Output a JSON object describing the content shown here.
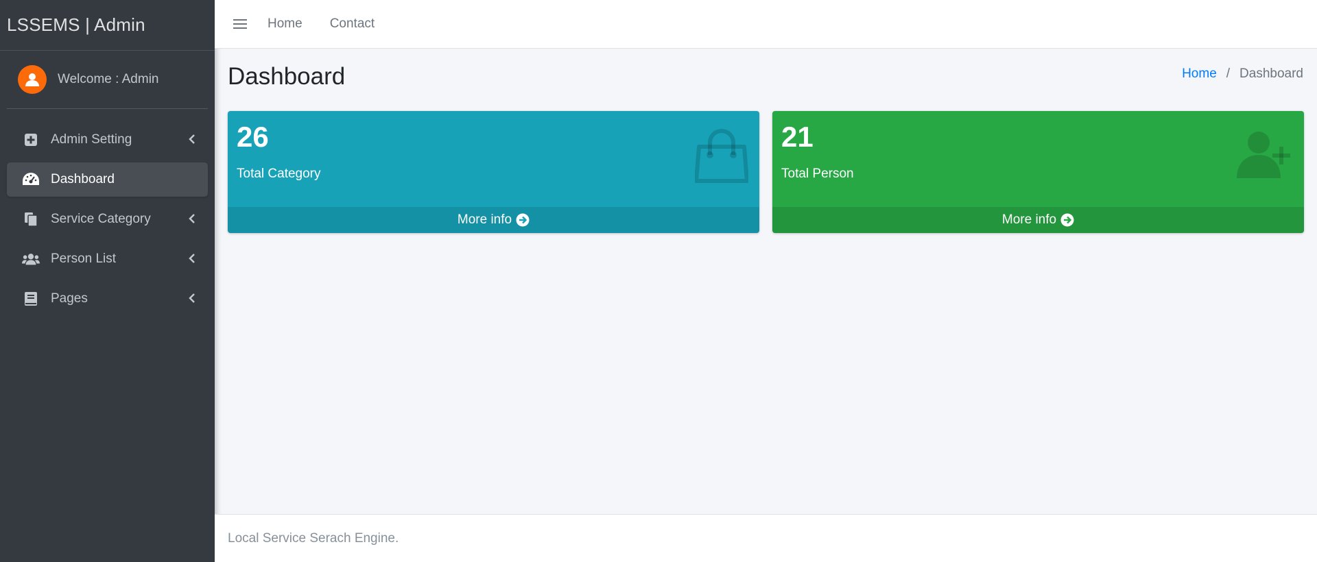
{
  "brand": {
    "title": "LSSEMS | Admin"
  },
  "user": {
    "welcome": "Welcome : Admin",
    "avatar_icon": "user-icon"
  },
  "sidebar": {
    "items": [
      {
        "label": "Admin Setting",
        "icon": "plus-square-icon",
        "has_arrow": true,
        "active": false
      },
      {
        "label": "Dashboard",
        "icon": "tachometer-icon",
        "has_arrow": false,
        "active": true
      },
      {
        "label": "Service Category",
        "icon": "copy-icon",
        "has_arrow": true,
        "active": false
      },
      {
        "label": "Person List",
        "icon": "users-icon",
        "has_arrow": true,
        "active": false
      },
      {
        "label": "Pages",
        "icon": "book-icon",
        "has_arrow": true,
        "active": false
      }
    ]
  },
  "topbar": {
    "menu_icon": "hamburger-icon",
    "links": [
      "Home",
      "Contact"
    ]
  },
  "header": {
    "title": "Dashboard",
    "breadcrumb": {
      "home": "Home",
      "separator": "/",
      "current": "Dashboard"
    }
  },
  "boxes": [
    {
      "value": "26",
      "label": "Total Category",
      "footer": "More info",
      "icon": "shopping-bag-icon",
      "color": "#17a2b8"
    },
    {
      "value": "21",
      "label": "Total Person",
      "footer": "More info",
      "icon": "user-plus-icon",
      "color": "#28a745"
    }
  ],
  "footer": {
    "text": "Local Service Serach Engine."
  },
  "colors": {
    "sidebar": "#343a40",
    "accent": "#007bff",
    "avatar": "#fd6a0a",
    "content_bg": "#f4f6f9"
  }
}
